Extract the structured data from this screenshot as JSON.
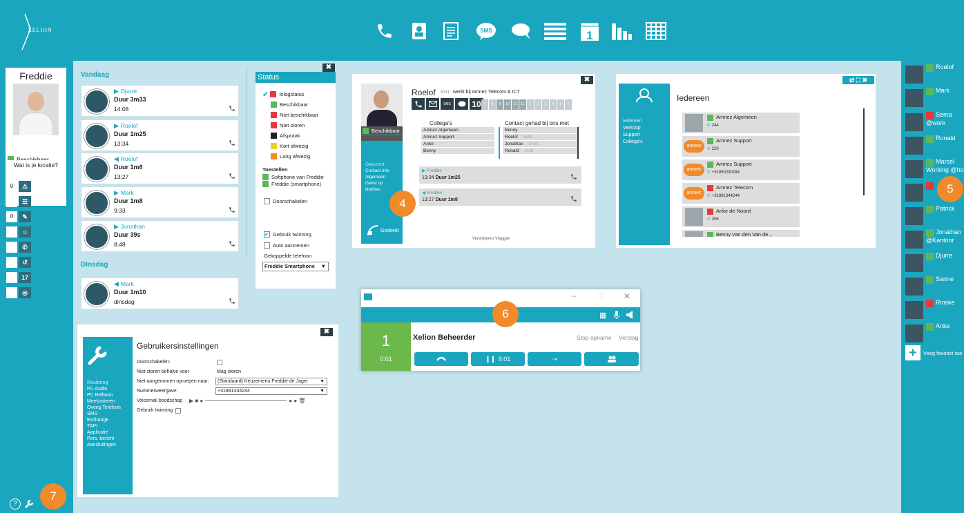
{
  "app": {
    "logo": "XELION"
  },
  "topnav": {
    "icons": [
      "phone-icon",
      "contacts-icon",
      "notes-icon",
      "sms-icon",
      "chat-icon",
      "list-icon",
      "calendar-icon",
      "stats-icon",
      "grid-icon"
    ]
  },
  "user": {
    "name": "Freddie",
    "status": "Beschikbaar",
    "location_prompt": "Wat is je locatie?"
  },
  "leftnav": {
    "items": [
      {
        "count": "0",
        "icon": "warning-icon"
      },
      {
        "count": "",
        "icon": "list-icon"
      },
      {
        "count": "0",
        "icon": "pen-icon"
      },
      {
        "count": "",
        "icon": "contacts-icon"
      },
      {
        "count": "",
        "icon": "phone-icon"
      },
      {
        "count": "",
        "icon": "history-icon"
      },
      {
        "count": "",
        "icon": "calendar-icon"
      },
      {
        "count": "",
        "icon": "voicemail-icon"
      }
    ]
  },
  "history": {
    "today_label": "Vandaag",
    "yesterday_label": "Dinsdag",
    "today": [
      {
        "name": "Djurre",
        "dir": "out",
        "duration": "Duur 3m33",
        "time": "14:08"
      },
      {
        "name": "Roelof",
        "dir": "out",
        "duration": "Duur 1m25",
        "time": "13:34"
      },
      {
        "name": "Roelof",
        "dir": "in",
        "duration": "Duur 1m8",
        "time": "13:27"
      },
      {
        "name": "Mark",
        "dir": "out",
        "duration": "Duur 1m8",
        "time": "9:33"
      },
      {
        "name": "Jonathan",
        "dir": "out",
        "duration": "Duur 39s",
        "time": "8:48"
      }
    ],
    "tuesday": [
      {
        "name": "Mark",
        "dir": "in",
        "duration": "Duur 1m10",
        "time": "dinsdag"
      }
    ]
  },
  "status_panel": {
    "title": "Status",
    "items": [
      {
        "label": "Inlogstatus",
        "color": "#e23a3a"
      },
      {
        "label": "Beschikbaar",
        "color": "#5bb85a"
      },
      {
        "label": "Niet beschikbaar",
        "color": "#e23a3a"
      },
      {
        "label": "Niet storen",
        "color": "#e23a3a"
      },
      {
        "label": "Afspraak",
        "color": "#222222"
      },
      {
        "label": "Kort afwezig",
        "color": "#e8d22a"
      },
      {
        "label": "Lang afwezig",
        "color": "#f08a2a"
      }
    ],
    "devices_label": "Toestellen",
    "devices": [
      "Softphone van Freddie",
      "Freddie (smartphone)"
    ],
    "forward_label": "Doorschakelen",
    "twinning_label": "Gebruik twinning",
    "auto_label": "Auto aannemen",
    "linked_label": "Gekoppelde telefoon",
    "linked_value": "Freddie Smartphone"
  },
  "contact_card": {
    "name": "Roelof",
    "ext": "6311",
    "company": "werkt bij Amnez Telecom & ICT",
    "status": "Beschikbaar",
    "calendar_day": "10",
    "hours": [
      "7",
      "8",
      "9",
      "10",
      "11",
      "12",
      "1",
      "2",
      "3",
      "4",
      "5",
      "6"
    ],
    "menu": [
      "Overzicht",
      "Contact info",
      "Algemeen",
      "Gelist op",
      "Notities"
    ],
    "shared": "Gedeeld",
    "colleagues_label": "Collega's",
    "colleagues": [
      "Amnez Algemeen",
      "Amnez Support",
      "Anke",
      "Benny"
    ],
    "contacts_label": "Contact gehad bij ons met",
    "contacts": [
      {
        "name": "Benny",
        "time": ""
      },
      {
        "name": "Roelof",
        "time": "16:00"
      },
      {
        "name": "Jonathan",
        "time": "14:43"
      },
      {
        "name": "Ronald",
        "time": "14:18"
      }
    ],
    "calls": [
      {
        "name": "Freddie",
        "dir": "out",
        "time": "13:34",
        "duration": "Duur 1m25"
      },
      {
        "name": "Freddie",
        "dir": "in",
        "time": "13:27",
        "duration": "Duur 1m8"
      }
    ],
    "footer": "Verwijderen  Vlaggen"
  },
  "directory": {
    "title": "Iedereen",
    "groups": [
      "Iedereen",
      "Verkoop",
      "Support",
      "Collega's"
    ],
    "entries": [
      {
        "name": "Amnez Algemeen",
        "number": "244",
        "color": "#5bb85a",
        "avatar": "person"
      },
      {
        "name": "Amnez Support",
        "number": "220",
        "color": "#5bb85a",
        "avatar": "amnez"
      },
      {
        "name": "Amnez Support",
        "number": "+31850290294",
        "color": "#5bb85a",
        "avatar": "amnez"
      },
      {
        "name": "Amnez Telecom",
        "number": "+31881344244",
        "color": "#e23a3a",
        "avatar": "amnez"
      },
      {
        "name": "Anke de Noord",
        "number": "206",
        "color": "#e23a3a",
        "avatar": "person"
      },
      {
        "name": "Benny van den Van de...",
        "number": "",
        "color": "#5bb85a",
        "avatar": "person"
      }
    ]
  },
  "softphone": {
    "line": "1",
    "time": "0:01",
    "caller": "Xelion Beheerder",
    "stop": "Stop opname",
    "transfer_label": "Verslag",
    "hold_time": "9:01"
  },
  "settings": {
    "title": "Gebruikersinstellingen",
    "menu": [
      "Routering",
      "PC Audio",
      "PC Belltoon",
      "Meeluisteren",
      "Overig Telefoon",
      "SMS",
      "Exchange",
      "TAPI",
      "Applicatie",
      "Pers. bericht",
      "Aansluitingen"
    ],
    "rows": [
      {
        "label": "Doorschakelen:",
        "value": ""
      },
      {
        "label": "Niet storen behalve voor",
        "value": "Mag storen"
      },
      {
        "label": "Niet aangenomen oproepen naar:",
        "value": "(Standaard) Keuzemenu Freddie de Jager"
      },
      {
        "label": "Nummerweergave:",
        "value": "+31881344244"
      },
      {
        "label": "Voicemail boodschap",
        "value": ""
      },
      {
        "label": "Gebruik twinning",
        "value": ""
      }
    ]
  },
  "favorites": {
    "items": [
      {
        "name": "Roelof",
        "sub": "",
        "color": "#5bb85a"
      },
      {
        "name": "Mark",
        "sub": "",
        "color": "#5bb85a"
      },
      {
        "name": "Sema",
        "sub": "@work",
        "color": "#e23a3a"
      },
      {
        "name": "Ronald",
        "sub": "",
        "color": "#5bb85a"
      },
      {
        "name": "Marcel",
        "sub": "Working @ho...",
        "color": "#5bb85a"
      },
      {
        "name": "",
        "sub": "",
        "color": "#e23a3a"
      },
      {
        "name": "Patrick",
        "sub": "",
        "color": "#5bb85a"
      },
      {
        "name": "Jonathan",
        "sub": "@Kantoor",
        "color": "#5bb85a"
      },
      {
        "name": "Djurre",
        "sub": "",
        "color": "#5bb85a"
      },
      {
        "name": "Sanne",
        "sub": "",
        "color": "#5bb85a"
      },
      {
        "name": "Rinske",
        "sub": "",
        "color": "#e23a3a"
      },
      {
        "name": "Anke",
        "sub": "",
        "color": "#5bb85a"
      }
    ],
    "add_label": "Voeg favoriet toe"
  },
  "callouts": [
    "4",
    "5",
    "6",
    "7"
  ]
}
